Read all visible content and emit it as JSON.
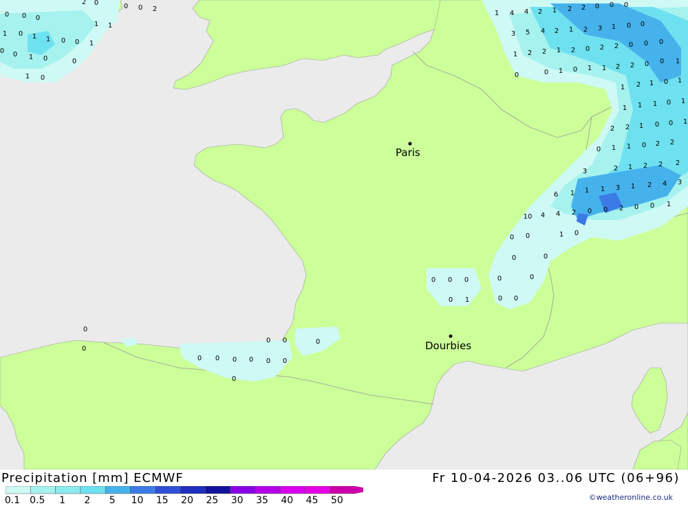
{
  "map": {
    "colors": {
      "sea": "#ebebeb",
      "land": "#ccff99",
      "border": "#9a9a9a",
      "precip_0_1": "#cff9f5",
      "precip_1_2": "#a6f2ee",
      "precip_2_5": "#6ee1f0",
      "precip_5_10": "#46b2ec",
      "precip_10_15": "#3c7be6"
    },
    "cities": [
      {
        "name": "Paris"
      },
      {
        "name": "Dourbies"
      }
    ],
    "precip_values": [
      "0",
      "0",
      "0",
      "2",
      "0",
      "0",
      "0",
      "2",
      "1",
      "1",
      "1",
      "0",
      "1",
      "1",
      "0",
      "0",
      "1",
      "0",
      "0",
      "1",
      "0",
      "0",
      "1",
      "0",
      "1",
      "4",
      "4",
      "2",
      "1",
      "2",
      "2",
      "0",
      "0",
      "0",
      "3",
      "5",
      "4",
      "2",
      "1",
      "2",
      "3",
      "1",
      "0",
      "0",
      "1",
      "2",
      "2",
      "1",
      "2",
      "0",
      "2",
      "2",
      "0",
      "0",
      "0",
      "0",
      "0",
      "1",
      "0",
      "1",
      "1",
      "2",
      "2",
      "0",
      "0",
      "1",
      "1",
      "2",
      "1",
      "0",
      "1",
      "1",
      "1",
      "1",
      "0",
      "1",
      "2",
      "2",
      "1",
      "0",
      "0",
      "1",
      "0",
      "1",
      "1",
      "0",
      "2",
      "2",
      "3",
      "2",
      "1",
      "2",
      "2",
      "2",
      "6",
      "1",
      "1",
      "1",
      "3",
      "1",
      "2",
      "4",
      "3",
      "10",
      "4",
      "4",
      "2",
      "0",
      "0",
      "2",
      "0",
      "0",
      "1",
      "0",
      "0",
      "1",
      "0",
      "0",
      "0",
      "0",
      "0",
      "0",
      "0",
      "0",
      "0",
      "1",
      "0",
      "0",
      "0",
      "0",
      "0",
      "0",
      "0",
      "0",
      "0",
      "0",
      "0",
      "0",
      "0",
      "0"
    ]
  },
  "footer": {
    "title": "Precipitation [mm] ECMWF",
    "datetime": "Fr 10-04-2026 03..06 UTC (06+96)",
    "credit": "©weatheronline.co.uk"
  },
  "legend": {
    "labels": [
      "0.1",
      "0.5",
      "1",
      "2",
      "5",
      "10",
      "15",
      "20",
      "25",
      "30",
      "35",
      "40",
      "45",
      "50"
    ],
    "colors": [
      "#cff9f5",
      "#a6f2ee",
      "#8cebed",
      "#6ee1f0",
      "#46b2ec",
      "#3c7be6",
      "#2f4fd6",
      "#1f2ebf",
      "#12129a",
      "#8a00e6",
      "#b400e6",
      "#d900ee",
      "#e600e6",
      "#cc00aa"
    ]
  }
}
